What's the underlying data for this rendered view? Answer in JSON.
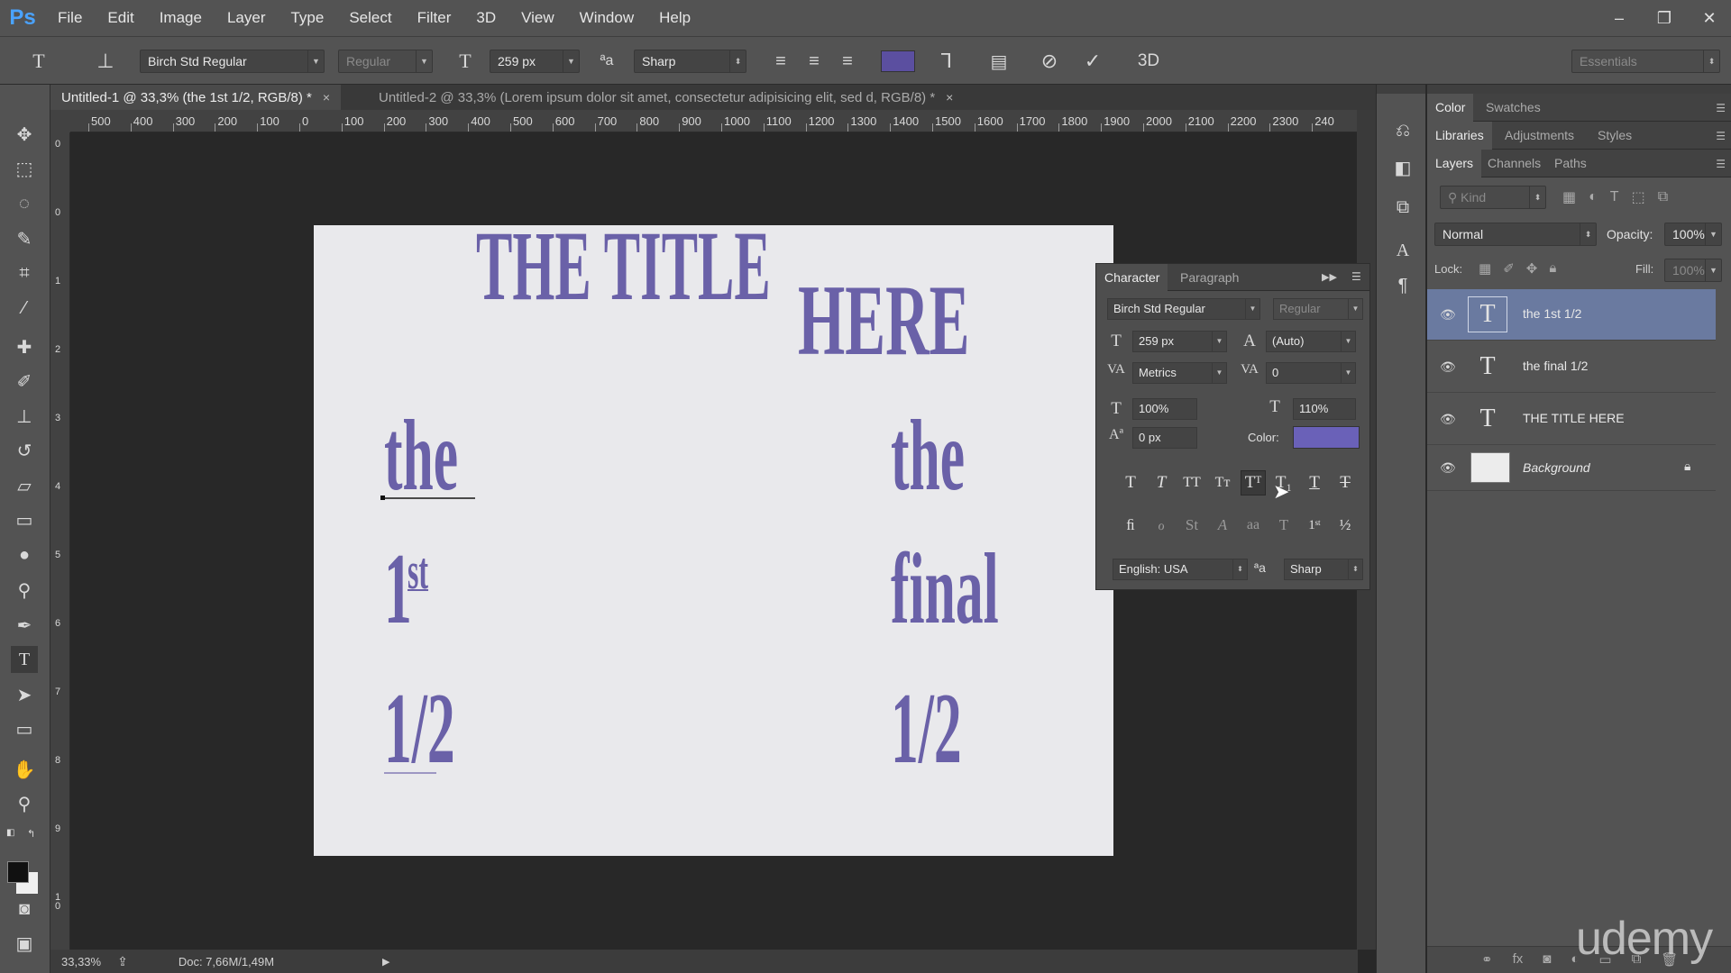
{
  "app": {
    "logo": "Ps"
  },
  "menu": [
    "File",
    "Edit",
    "Image",
    "Layer",
    "Type",
    "Select",
    "Filter",
    "3D",
    "View",
    "Window",
    "Help"
  ],
  "window_controls": {
    "minimize": "–",
    "restore": "❐",
    "close": "✕"
  },
  "options_bar": {
    "font_family": "Birch Std Regular",
    "font_style": "Regular",
    "font_size": "259 px",
    "antialias": "Sharp",
    "text_color": "#5b4fa0",
    "workspace": "Essentials",
    "threed": "3D"
  },
  "tabs": [
    {
      "label": "Untitled-1 @ 33,3% (the 1st 1/2, RGB/8) *",
      "close": "×"
    },
    {
      "label": "Untitled-2 @ 33,3% (Lorem ipsum dolor sit amet, consectetur adipisicing elit, sed d, RGB/8) *",
      "close": "×"
    }
  ],
  "ruler": {
    "h": [
      "500",
      "400",
      "300",
      "200",
      "100",
      "0",
      "100",
      "200",
      "300",
      "400",
      "500",
      "600",
      "700",
      "800",
      "900",
      "1000",
      "1100",
      "1200",
      "1300",
      "1400",
      "1500",
      "1600",
      "1700",
      "1800",
      "1900",
      "2000",
      "2100",
      "2200",
      "2300",
      "240"
    ],
    "v": [
      "0",
      "0",
      "1",
      "2",
      "3",
      "4",
      "5",
      "6",
      "7",
      "8",
      "9",
      "1\n0"
    ]
  },
  "canvas": {
    "title_l1": "THE TITLE",
    "title_l2": "HERE",
    "left_col": {
      "w1": "the",
      "w2": "1",
      "sup": "st",
      "w3": "1/2"
    },
    "right_col": {
      "w1": "the",
      "w2": "final",
      "w3": "1/2"
    }
  },
  "status": {
    "zoom": "33,33%",
    "doc": "Doc: 7,66M/1,49M"
  },
  "panels": {
    "top_tabs": [
      "Color",
      "Swatches"
    ],
    "mid_tabs": [
      "Libraries",
      "Adjustments",
      "Styles"
    ],
    "layer_tabs": [
      "Layers",
      "Channels",
      "Paths"
    ],
    "kind": "Kind",
    "blend_mode": "Normal",
    "opacity_label": "Opacity:",
    "opacity_value": "100%",
    "lock_label": "Lock:",
    "fill_label": "Fill:",
    "fill_value": "100%",
    "layers": [
      {
        "name": "the 1st 1/2",
        "type": "text",
        "selected": true
      },
      {
        "name": "the final  1/2",
        "type": "text",
        "selected": false
      },
      {
        "name": "THE TITLE HERE",
        "type": "text",
        "selected": false
      },
      {
        "name": "Background",
        "type": "raster",
        "selected": false
      }
    ]
  },
  "character": {
    "tabs": [
      "Character",
      "Paragraph"
    ],
    "font_family": "Birch Std Regular",
    "font_style": "Regular",
    "size": "259 px",
    "leading": "(Auto)",
    "kerning": "Metrics",
    "tracking": "0",
    "vscale": "100%",
    "hscale": "110%",
    "baseline": "0 px",
    "color_label": "Color:",
    "color": "#6a61b8",
    "language": "English: USA",
    "antialias": "Sharp"
  },
  "watermark": "udemy"
}
